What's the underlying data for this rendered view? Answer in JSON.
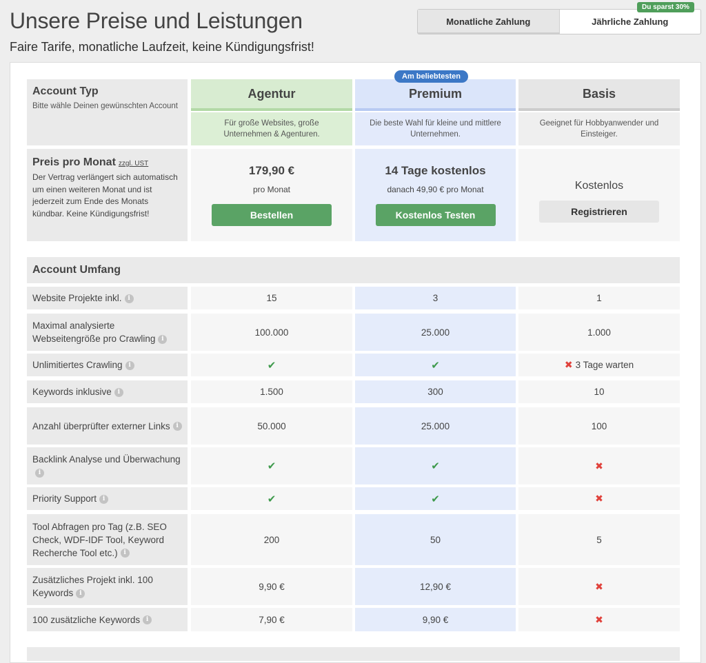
{
  "header": {
    "title": "Unsere Preise und Leistungen",
    "subtitle": "Faire Tarife, monatliche Laufzeit, keine Kündigungsfrist!"
  },
  "billing": {
    "monthly_label": "Monatliche Zahlung",
    "yearly_label": "Jährliche Zahlung",
    "savings_badge": "Du sparst 30%"
  },
  "account_type": {
    "title": "Account Typ",
    "hint": "Bitte wähle Deinen gewünschten Account"
  },
  "plans": {
    "agentur": {
      "name": "Agentur",
      "desc": "Für große Websites, große Unternehmen & Agenturen.",
      "price": "179,90 €",
      "price_sub": "pro Monat",
      "cta": "Bestellen"
    },
    "premium": {
      "name": "Premium",
      "badge": "Am beliebtesten",
      "desc": "Die beste Wahl für kleine und mittlere Unternehmen.",
      "price": "14 Tage kostenlos",
      "price_sub": "danach 49,90 € pro Monat",
      "cta": "Kostenlos Testen"
    },
    "basis": {
      "name": "Basis",
      "desc": "Geeignet für Hobbyanwender und Einsteiger.",
      "price": "Kostenlos",
      "cta": "Registrieren"
    }
  },
  "price_row": {
    "title": "Preis pro Monat",
    "tax_note": "zzgl. UST",
    "text": "Der Vertrag verlängert sich automatisch um einen weiteren Monat und ist jederzeit zum Ende des Monats kündbar. Keine Kündigungsfrist!"
  },
  "section": {
    "title": "Account Umfang"
  },
  "features": [
    {
      "label": "Website Projekte inkl.",
      "agentur": "15",
      "premium": "3",
      "basis": "1"
    },
    {
      "label": "Maximal analysierte Webseitengröße pro Crawling",
      "agentur": "100.000",
      "premium": "25.000",
      "basis": "1.000"
    },
    {
      "label": "Unlimitiertes Crawling",
      "agentur": "✔",
      "premium": "✔",
      "basis": "3 Tage warten"
    },
    {
      "label": "Keywords inklusive",
      "agentur": "1.500",
      "premium": "300",
      "basis": "10"
    },
    {
      "label": "Anzahl überprüfter externer Links",
      "agentur": "50.000",
      "premium": "25.000",
      "basis": "100"
    },
    {
      "label": "Backlink Analyse und Überwachung",
      "agentur": "✔",
      "premium": "✔",
      "basis": "✖"
    },
    {
      "label": "Priority Support",
      "agentur": "✔",
      "premium": "✔",
      "basis": "✖"
    },
    {
      "label": "Tool Abfragen pro Tag (z.B. SEO Check, WDF-IDF Tool, Keyword Recherche Tool etc.)",
      "agentur": "200",
      "premium": "50",
      "basis": "5"
    },
    {
      "label": "Zusätzliches Projekt inkl. 100 Keywords",
      "agentur": "9,90 €",
      "premium": "12,90 €",
      "basis": "✖"
    },
    {
      "label": "100 zusätzliche Keywords",
      "agentur": "7,90 €",
      "premium": "9,90 €",
      "basis": "✖"
    }
  ],
  "icons": {
    "check": "check-icon",
    "cross": "cross-icon",
    "info": "info-icon"
  },
  "colors": {
    "accent_green": "#5aa365",
    "premium_blue": "#3c78c6",
    "cross_red": "#e0413b"
  }
}
